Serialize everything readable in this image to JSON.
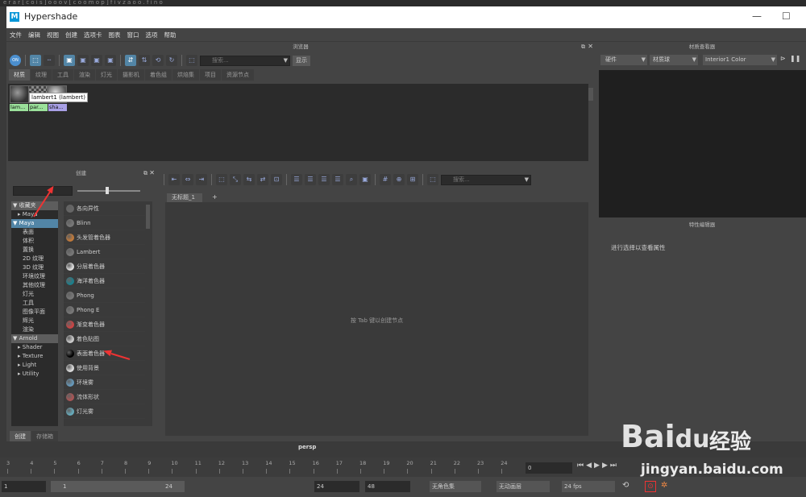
{
  "top_strip": "e r a r [ c o i s ] o o o v [ c o o m o p ] f i v z a o o . f i n o",
  "window": {
    "title": "Hypershade",
    "logo": "M"
  },
  "menu": [
    "文件",
    "编辑",
    "视图",
    "创建",
    "选项卡",
    "图表",
    "窗口",
    "选项",
    "帮助"
  ],
  "browser": {
    "title": "浏览器",
    "search_placeholder": "搜索...",
    "show_button": "显示",
    "tabs": [
      "材质",
      "纹理",
      "工具",
      "渲染",
      "灯光",
      "摄影机",
      "着色组",
      "烘焙集",
      "项目",
      "资源节点"
    ],
    "active_tab": "材质",
    "swatches": [
      {
        "label": "lam...",
        "color": "#9be19b"
      },
      {
        "label": "par...",
        "color": "#9be19b"
      },
      {
        "label": "sha...",
        "color": "#a8a0e6"
      }
    ],
    "tooltip": "lambert1 (lambert)"
  },
  "material_viewer": {
    "title": "材质查看器",
    "renderer": "硬件",
    "shape": "材质球",
    "env": "Interior1 Color"
  },
  "attribute_editor": {
    "title": "特性编辑器",
    "hint": "进行选择以查看属性"
  },
  "create_panel": {
    "title": "创建",
    "tree": [
      {
        "label": "收藏夹",
        "kind": "hd",
        "indent": 0,
        "arrow": "▼"
      },
      {
        "label": "Maya",
        "kind": "",
        "indent": 1,
        "arrow": "▸"
      },
      {
        "label": "Maya",
        "kind": "sel",
        "indent": 0,
        "arrow": "▼"
      },
      {
        "label": "表面",
        "kind": "",
        "indent": 2,
        "arrow": ""
      },
      {
        "label": "体积",
        "kind": "",
        "indent": 2,
        "arrow": ""
      },
      {
        "label": "置换",
        "kind": "",
        "indent": 2,
        "arrow": ""
      },
      {
        "label": "2D 纹理",
        "kind": "",
        "indent": 2,
        "arrow": ""
      },
      {
        "label": "3D 纹理",
        "kind": "",
        "indent": 2,
        "arrow": ""
      },
      {
        "label": "环境纹理",
        "kind": "",
        "indent": 2,
        "arrow": ""
      },
      {
        "label": "其他纹理",
        "kind": "",
        "indent": 2,
        "arrow": ""
      },
      {
        "label": "灯光",
        "kind": "",
        "indent": 2,
        "arrow": ""
      },
      {
        "label": "工具",
        "kind": "",
        "indent": 2,
        "arrow": ""
      },
      {
        "label": "图像平面",
        "kind": "",
        "indent": 2,
        "arrow": ""
      },
      {
        "label": "辉光",
        "kind": "",
        "indent": 2,
        "arrow": ""
      },
      {
        "label": "渲染",
        "kind": "",
        "indent": 2,
        "arrow": ""
      },
      {
        "label": "Arnold",
        "kind": "hd",
        "indent": 0,
        "arrow": "▼"
      },
      {
        "label": "Shader",
        "kind": "",
        "indent": 1,
        "arrow": "▸"
      },
      {
        "label": "Texture",
        "kind": "",
        "indent": 1,
        "arrow": "▸"
      },
      {
        "label": "Light",
        "kind": "",
        "indent": 1,
        "arrow": "▸"
      },
      {
        "label": "Utility",
        "kind": "",
        "indent": 1,
        "arrow": "▸"
      }
    ],
    "nodes": [
      {
        "label": "各向异性",
        "color": "#666"
      },
      {
        "label": "Blinn",
        "color": "#777"
      },
      {
        "label": "头发管着色器",
        "color": "#c27a3a"
      },
      {
        "label": "Lambert",
        "color": "#777"
      },
      {
        "label": "分层着色器",
        "color": "#ddd"
      },
      {
        "label": "海洋着色器",
        "color": "#1c7f8c"
      },
      {
        "label": "Phong",
        "color": "#777"
      },
      {
        "label": "Phong E",
        "color": "#777"
      },
      {
        "label": "渐变着色器",
        "color": "#c44"
      },
      {
        "label": "着色贴图",
        "color": "#ccc"
      },
      {
        "label": "表面着色器",
        "color": "#000"
      },
      {
        "label": "使用背景",
        "color": "#ddd"
      },
      {
        "label": "环境雾",
        "color": "#69b"
      },
      {
        "label": "流体形状",
        "color": "#a55"
      },
      {
        "label": "灯光雾",
        "color": "#6ab"
      }
    ],
    "bottom_tabs": [
      "创建",
      "存储箱"
    ]
  },
  "graph": {
    "tab": "无标题_1",
    "add_tab": "+",
    "hint": "按 Tab 键以创建节点",
    "search_placeholder": "搜索..."
  },
  "viewport_label": "persp",
  "timeline": {
    "ticks": [
      "3",
      "4",
      "5",
      "6",
      "7",
      "8",
      "9",
      "10",
      "11",
      "12",
      "13",
      "14",
      "15",
      "16",
      "17",
      "18",
      "19",
      "20",
      "21",
      "22",
      "23",
      "24"
    ],
    "current_frame": "0"
  },
  "range": {
    "start": "1",
    "slider_start": "1",
    "slider_end": "24",
    "end": "24",
    "anim_end": "48",
    "char_set": "无角色集",
    "anim_layer": "无动画层",
    "fps": "24 fps"
  },
  "watermark": {
    "brand": "Bai",
    "brand2": "du",
    "brand3": "经验",
    "url": "jingyan.baidu.com"
  }
}
